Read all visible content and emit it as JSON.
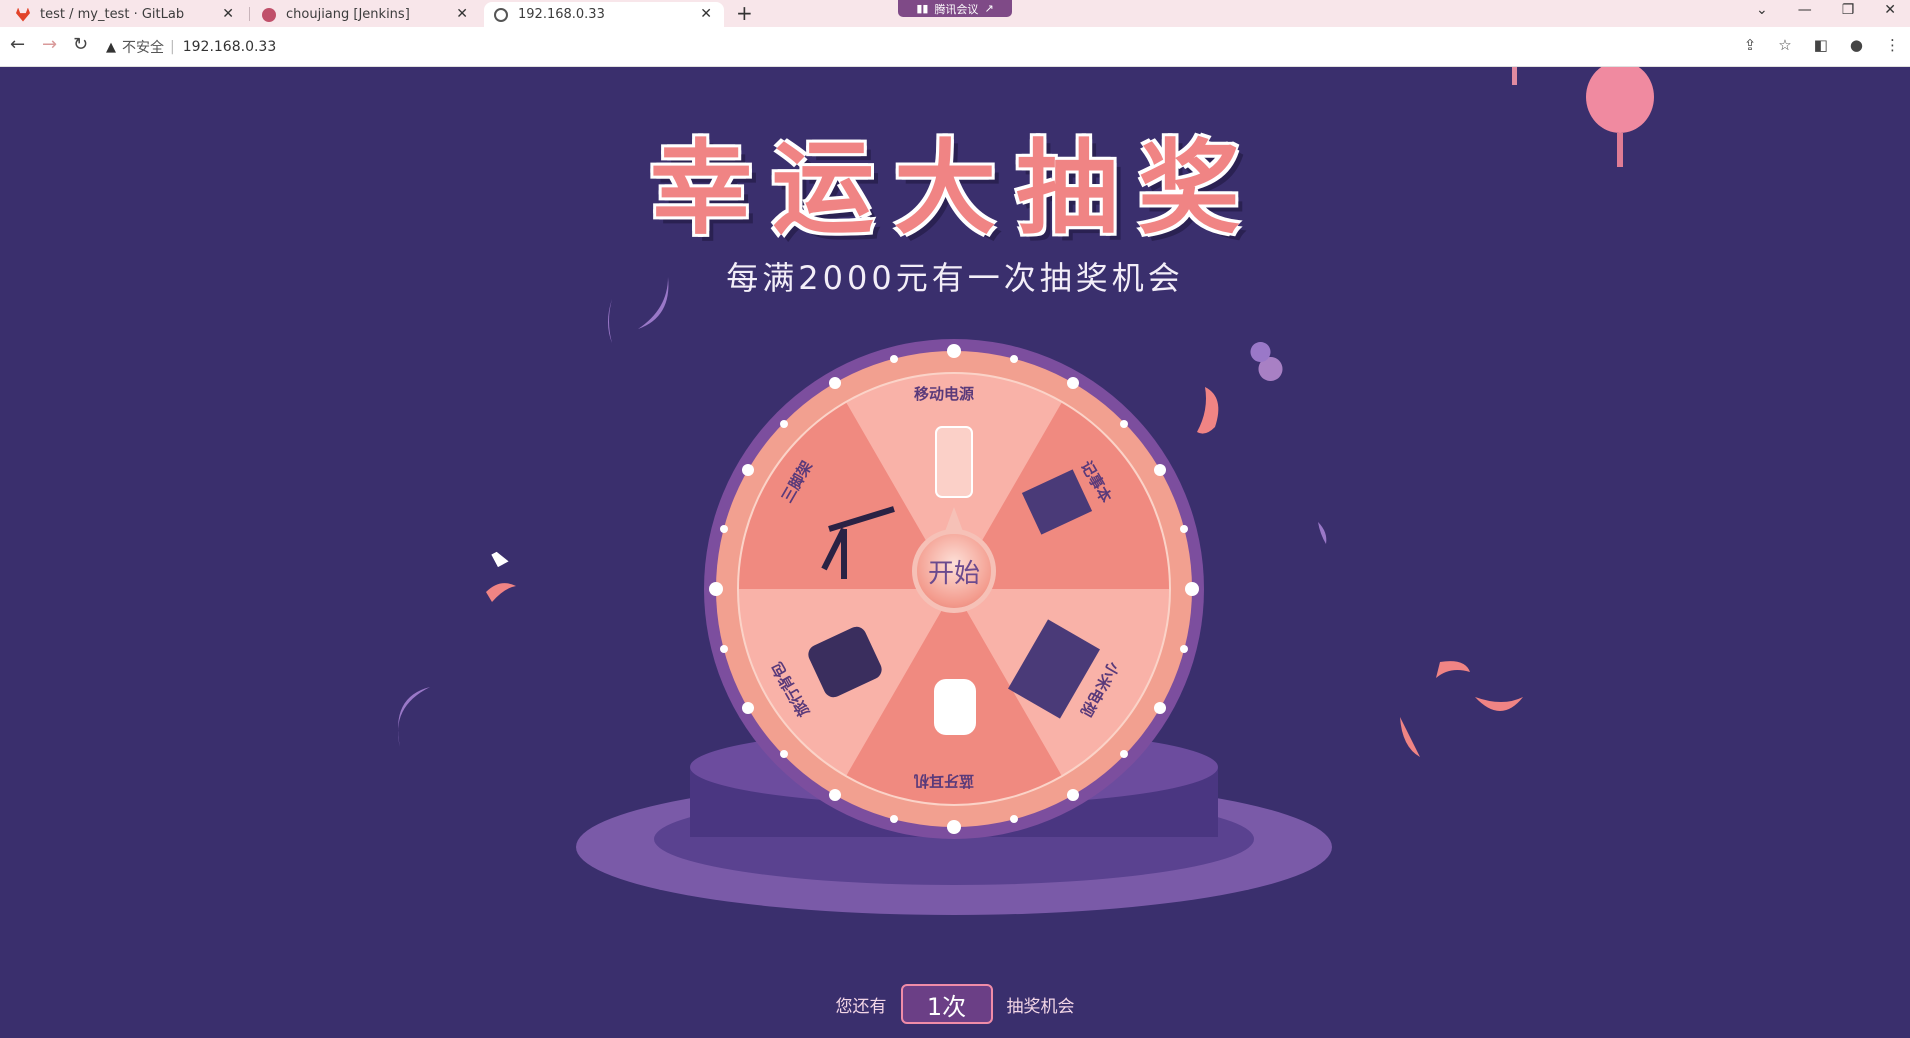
{
  "browser": {
    "tabs": [
      {
        "title": "test / my_test · GitLab",
        "icon": "gitlab-icon"
      },
      {
        "title": "choujiang [Jenkins]",
        "icon": "jenkins-icon"
      },
      {
        "title": "192.168.0.33",
        "icon": "globe-icon"
      }
    ],
    "meeting_badge": "腾讯会议",
    "security_label": "不安全",
    "url": "192.168.0.33"
  },
  "page": {
    "title": "幸运大抽奖",
    "subtitle": "每满2000元有一次抽奖机会",
    "start_label": "开始",
    "prizes": [
      "移动电源",
      "记事本",
      "小米电视",
      "蓝牙耳机",
      "旅行背包",
      "三脚架"
    ],
    "remaining_prefix": "您还有",
    "remaining_count": "1次",
    "remaining_suffix": "抽奖机会"
  },
  "colors": {
    "background": "#3a2f6d",
    "accent_pink": "#f08484",
    "wheel_rim": "#8c5aa6",
    "wheel_segment_light": "#f7a59a",
    "wheel_segment_dark": "#f08a80"
  }
}
